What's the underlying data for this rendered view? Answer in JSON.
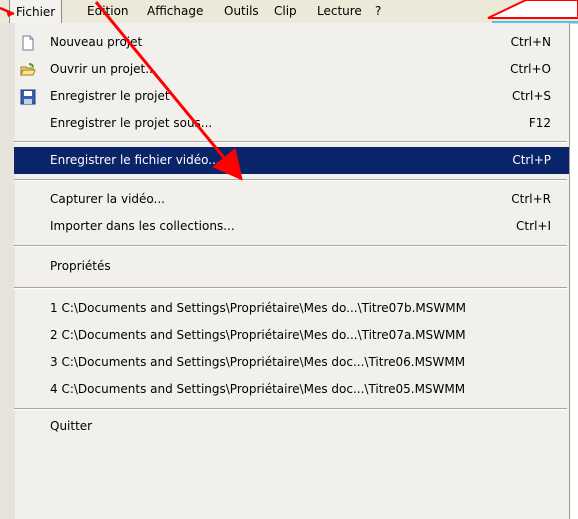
{
  "menubar": {
    "items": [
      {
        "label": "Fichier"
      },
      {
        "label": "Edition"
      },
      {
        "label": "Affichage"
      },
      {
        "label": "Outils"
      },
      {
        "label": "Clip"
      },
      {
        "label": "Lecture"
      },
      {
        "label": "?"
      }
    ]
  },
  "menu": {
    "items": [
      {
        "label": "Nouveau projet",
        "shortcut": "Ctrl+N",
        "icon": "new-document-icon"
      },
      {
        "label": "Ouvrir un projet...",
        "shortcut": "Ctrl+O",
        "icon": "open-folder-icon"
      },
      {
        "label": "Enregistrer le projet",
        "shortcut": "Ctrl+S",
        "icon": "save-disk-icon"
      },
      {
        "label": "Enregistrer le projet sous...",
        "shortcut": "F12"
      },
      {
        "label": "Enregistrer le fichier vidéo...",
        "shortcut": "Ctrl+P",
        "highlighted": true
      },
      {
        "label": "Capturer la vidéo...",
        "shortcut": "Ctrl+R"
      },
      {
        "label": "Importer dans les collections...",
        "shortcut": "Ctrl+I"
      },
      {
        "label": "Propriétés"
      },
      {
        "label": "1 C:\\Documents and Settings\\Propriétaire\\Mes do...\\Titre07b.MSWMM"
      },
      {
        "label": "2 C:\\Documents and Settings\\Propriétaire\\Mes do...\\Titre07a.MSWMM"
      },
      {
        "label": "3 C:\\Documents and Settings\\Propriétaire\\Mes doc...\\Titre06.MSWMM"
      },
      {
        "label": "4 C:\\Documents and Settings\\Propriétaire\\Mes doc...\\Titre05.MSWMM"
      },
      {
        "label": "Quitter"
      }
    ]
  },
  "colors": {
    "highlight": "#0a246a",
    "annotation": "#ff0000"
  }
}
